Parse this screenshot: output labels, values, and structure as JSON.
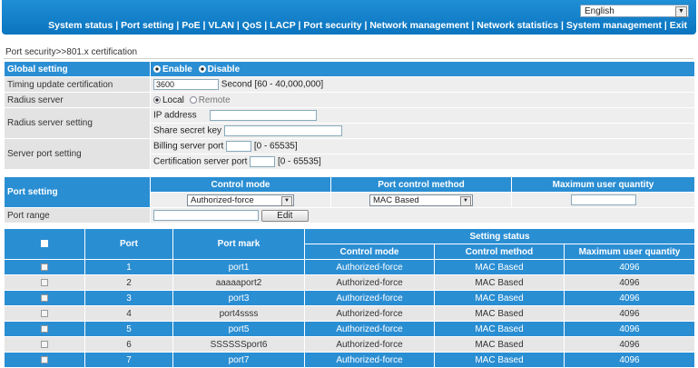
{
  "language": {
    "selected": "English"
  },
  "menu": {
    "items": [
      "System status",
      "Port setting",
      "PoE",
      "VLAN",
      "QoS",
      "LACP",
      "Port security",
      "Network management",
      "Network statistics",
      "System management",
      "Exit"
    ]
  },
  "breadcrumb": "Port security>>801.x certification",
  "global": {
    "label": "Global setting",
    "enable": "Enable",
    "disable": "Disable",
    "timing_label": "Timing update certification",
    "timing_value": "3600",
    "timing_hint": "Second [60 - 40,000,000]",
    "radius_label": "Radius server",
    "local": "Local",
    "remote": "Remote",
    "radius_setting_label": "Radius server setting",
    "ip_label": "IP address",
    "secret_label": "Share secret key",
    "server_port_label": "Server port setting",
    "billing_label": "Billing server port",
    "billing_hint": "[0 - 65535]",
    "cert_label": "Certification server port",
    "cert_hint": "[0 - 65535]"
  },
  "port_setting": {
    "label": "Port setting",
    "col_control_mode": "Control mode",
    "col_control_method": "Port control method",
    "col_max_users": "Maximum user quantity",
    "control_mode_value": "Authorized-force",
    "control_method_value": "MAC Based",
    "port_range_label": "Port range",
    "edit_label": "Edit"
  },
  "grid": {
    "col_port": "Port",
    "col_mark": "Port mark",
    "col_status": "Setting status",
    "sub_mode": "Control mode",
    "sub_method": "Control method",
    "sub_max": "Maximum user quantity",
    "rows": [
      {
        "port": "1",
        "mark": "port1",
        "mode": "Authorized-force",
        "method": "MAC Based",
        "max": "4096"
      },
      {
        "port": "2",
        "mark": "aaaaaport2",
        "mode": "Authorized-force",
        "method": "MAC Based",
        "max": "4096"
      },
      {
        "port": "3",
        "mark": "port3",
        "mode": "Authorized-force",
        "method": "MAC Based",
        "max": "4096"
      },
      {
        "port": "4",
        "mark": "port4ssss",
        "mode": "Authorized-force",
        "method": "MAC Based",
        "max": "4096"
      },
      {
        "port": "5",
        "mark": "port5",
        "mode": "Authorized-force",
        "method": "MAC Based",
        "max": "4096"
      },
      {
        "port": "6",
        "mark": "SSSSSSport6",
        "mode": "Authorized-force",
        "method": "MAC Based",
        "max": "4096"
      },
      {
        "port": "7",
        "mark": "port7",
        "mode": "Authorized-force",
        "method": "MAC Based",
        "max": "4096"
      }
    ]
  },
  "colors": {
    "header_blue": "#2a8ed3",
    "topbar_blue": "#0a74bf",
    "label_gray": "#e3e3e3"
  }
}
